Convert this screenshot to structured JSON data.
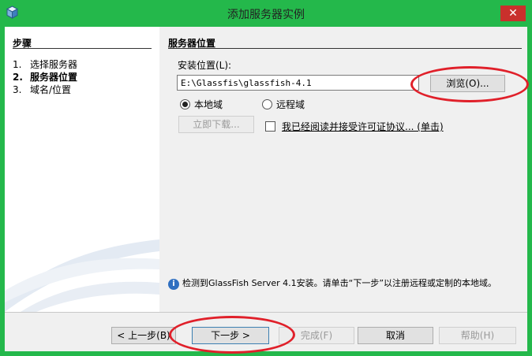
{
  "window": {
    "title": "添加服务器实例",
    "close": "✕"
  },
  "steps": {
    "title": "步骤",
    "items": [
      {
        "num": "1.",
        "label": "选择服务器"
      },
      {
        "num": "2.",
        "label": "服务器位置"
      },
      {
        "num": "3.",
        "label": "域名/位置"
      }
    ]
  },
  "panel": {
    "title": "服务器位置",
    "location_label": "安装位置(L):",
    "location_value": "E:\\Glassfis\\glassfish-4.1",
    "browse_label": "浏览(O)...",
    "radio_local": "本地域",
    "radio_remote": "远程域",
    "download_label": "立即下载...",
    "license_label": "我已经阅读并接受许可证协议... (单击)",
    "info_text": "检测到GlassFish Server 4.1安装。请单击“下一步”以注册远程或定制的本地域。"
  },
  "footer": {
    "back": "< 上一步(B)",
    "next": "下一步 >",
    "finish": "完成(F)",
    "cancel": "取消",
    "help": "帮助(H)"
  },
  "colors": {
    "frame": "#24b84b",
    "annotation": "#e0202a"
  }
}
